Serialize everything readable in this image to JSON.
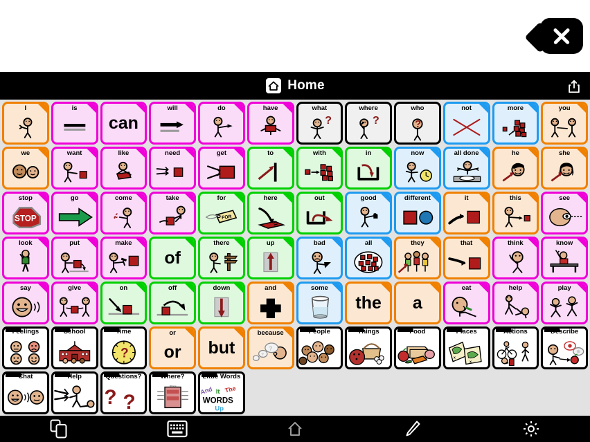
{
  "window": {
    "close_label": "close",
    "close_icon": "close-x-icon"
  },
  "header": {
    "title": "Home",
    "home_icon": "home-icon",
    "share_icon": "share-icon"
  },
  "grid": {
    "columns": 12,
    "rows": 7,
    "colors": {
      "pronoun_orange": "#F08000",
      "verb_magenta": "#F000D8",
      "preposition_green": "#00D000",
      "descriptor_blue": "#1E9BF0",
      "question_white": "#000000",
      "folder_black": "#000000"
    },
    "cells": [
      {
        "label": "I",
        "theme": "c-orange",
        "art": "person-point-self"
      },
      {
        "label": "is",
        "theme": "c-magenta",
        "art": "equals-bars"
      },
      {
        "label": "can",
        "theme": "c-magenta",
        "art": "word-can",
        "word": "can"
      },
      {
        "label": "will",
        "theme": "c-magenta",
        "art": "arrow-right-bar"
      },
      {
        "label": "do",
        "theme": "c-magenta",
        "art": "person-reaching"
      },
      {
        "label": "have",
        "theme": "c-magenta",
        "art": "person-holding-box"
      },
      {
        "label": "what",
        "theme": "c-white",
        "art": "person-question-shrug"
      },
      {
        "label": "where",
        "theme": "c-white",
        "art": "person-question-look"
      },
      {
        "label": "who",
        "theme": "c-white",
        "art": "person-question-head"
      },
      {
        "label": "not",
        "theme": "c-blue",
        "art": "red-x"
      },
      {
        "label": "more",
        "theme": "c-blue",
        "art": "blocks-pile-add"
      },
      {
        "label": "you",
        "theme": "c-orange",
        "art": "two-people-point"
      },
      {
        "label": "we",
        "theme": "c-orange",
        "art": "two-faces"
      },
      {
        "label": "want",
        "theme": "c-magenta",
        "art": "person-reach-box"
      },
      {
        "label": "like",
        "theme": "c-magenta",
        "art": "person-hug-box"
      },
      {
        "label": "need",
        "theme": "c-magenta",
        "art": "hands-toward-box"
      },
      {
        "label": "get",
        "theme": "c-magenta",
        "art": "hands-grab-box"
      },
      {
        "label": "to",
        "theme": "c-green",
        "art": "arrow-to-line"
      },
      {
        "label": "with",
        "theme": "c-green",
        "art": "block-joining-group"
      },
      {
        "label": "in",
        "theme": "c-green",
        "art": "arrow-into-container"
      },
      {
        "label": "now",
        "theme": "c-blue",
        "art": "person-clock"
      },
      {
        "label": "all done",
        "theme": "c-blue",
        "art": "person-empty-plate"
      },
      {
        "label": "he",
        "theme": "c-orange",
        "art": "boy-face-arrow"
      },
      {
        "label": "she",
        "theme": "c-orange",
        "art": "girl-face-arrow"
      },
      {
        "label": "stop",
        "theme": "c-magenta",
        "art": "stop-sign"
      },
      {
        "label": "go",
        "theme": "c-magenta",
        "art": "green-arrow"
      },
      {
        "label": "come",
        "theme": "c-magenta",
        "art": "person-beckon"
      },
      {
        "label": "take",
        "theme": "c-magenta",
        "art": "person-take-box"
      },
      {
        "label": "for",
        "theme": "c-green",
        "art": "gift-tag-for"
      },
      {
        "label": "here",
        "theme": "c-green",
        "art": "hand-point-surface"
      },
      {
        "label": "out",
        "theme": "c-green",
        "art": "arrow-out-container"
      },
      {
        "label": "good",
        "theme": "c-blue",
        "art": "person-thumbs-up"
      },
      {
        "label": "different",
        "theme": "c-blue",
        "art": "square-and-circle"
      },
      {
        "label": "it",
        "theme": "c-orange",
        "art": "hand-point-box"
      },
      {
        "label": "this",
        "theme": "c-orange",
        "art": "person-point-box"
      },
      {
        "label": "see",
        "theme": "c-magenta",
        "art": "eye-sight-line"
      },
      {
        "label": "look",
        "theme": "c-magenta",
        "art": "person-looking"
      },
      {
        "label": "put",
        "theme": "c-magenta",
        "art": "person-put-box"
      },
      {
        "label": "make",
        "theme": "c-magenta",
        "art": "person-hammer-box"
      },
      {
        "label": "of",
        "theme": "c-green",
        "art": "word-of",
        "word": "of"
      },
      {
        "label": "there",
        "theme": "c-green",
        "art": "person-signpost"
      },
      {
        "label": "up",
        "theme": "c-green",
        "art": "arrow-up-box"
      },
      {
        "label": "bad",
        "theme": "c-blue",
        "art": "person-thumbs-down"
      },
      {
        "label": "all",
        "theme": "c-blue",
        "art": "blocks-circled"
      },
      {
        "label": "they",
        "theme": "c-orange",
        "art": "group-people-arrow"
      },
      {
        "label": "that",
        "theme": "c-orange",
        "art": "hand-point-far-box"
      },
      {
        "label": "think",
        "theme": "c-magenta",
        "art": "person-thinking"
      },
      {
        "label": "know",
        "theme": "c-magenta",
        "art": "person-hand-raised-desk"
      },
      {
        "label": "say",
        "theme": "c-magenta",
        "art": "face-speaking"
      },
      {
        "label": "give",
        "theme": "c-magenta",
        "art": "person-give-box"
      },
      {
        "label": "on",
        "theme": "c-green",
        "art": "arrow-onto-surface"
      },
      {
        "label": "off",
        "theme": "c-green",
        "art": "arrow-off-surface"
      },
      {
        "label": "down",
        "theme": "c-green",
        "art": "arrow-down-box"
      },
      {
        "label": "and",
        "theme": "c-orange",
        "art": "plus-sign"
      },
      {
        "label": "some",
        "theme": "c-blue",
        "art": "glass-partly-full"
      },
      {
        "label": "the",
        "theme": "c-orange",
        "art": "word-the",
        "word": "the"
      },
      {
        "label": "a",
        "theme": "c-orange",
        "art": "word-a",
        "word": "a"
      },
      {
        "label": "eat",
        "theme": "c-magenta",
        "art": "person-eating"
      },
      {
        "label": "help",
        "theme": "c-magenta",
        "art": "person-helping"
      },
      {
        "label": "play",
        "theme": "c-magenta",
        "art": "two-people-running"
      },
      {
        "label": "Feelings",
        "theme": "c-folder",
        "art": "four-faces"
      },
      {
        "label": "School",
        "theme": "c-folder",
        "art": "school-building"
      },
      {
        "label": "Time",
        "theme": "c-folder",
        "art": "clock-question"
      },
      {
        "label": "or",
        "theme": "c-orange",
        "art": "word-or",
        "word": "or"
      },
      {
        "label": "but",
        "theme": "c-orange",
        "art": "word-but",
        "word": "but"
      },
      {
        "label": "because",
        "theme": "c-orange",
        "art": "speech-bubbles-question"
      },
      {
        "label": "People",
        "theme": "c-folder",
        "art": "crowd-faces"
      },
      {
        "label": "Things",
        "theme": "c-folder",
        "art": "basket-ball-objects"
      },
      {
        "label": "Food",
        "theme": "c-folder",
        "art": "bread-apple-carrot"
      },
      {
        "label": "Places",
        "theme": "c-folder",
        "art": "two-maps"
      },
      {
        "label": "Actions",
        "theme": "c-folder",
        "art": "cyclist-walker"
      },
      {
        "label": "Describe",
        "theme": "c-folder",
        "art": "person-describing-apple"
      },
      {
        "label": "Chat",
        "theme": "c-folder",
        "art": "two-faces-talking"
      },
      {
        "label": "Help",
        "theme": "c-folder",
        "art": "hands-helping-person"
      },
      {
        "label": "Questions?",
        "theme": "c-folder",
        "art": "two-question-marks"
      },
      {
        "label": "Where?",
        "theme": "c-folder",
        "art": "red-sign-board"
      },
      {
        "label": "Little Words",
        "theme": "c-folder",
        "art": "words-collage"
      }
    ]
  },
  "toolbar": {
    "items": [
      {
        "name": "pages-icon",
        "label": "Pages"
      },
      {
        "name": "keyboard-icon",
        "label": "Keyboard"
      },
      {
        "name": "home-icon",
        "label": "Home"
      },
      {
        "name": "edit-icon",
        "label": "Edit"
      },
      {
        "name": "settings-icon",
        "label": "Settings"
      }
    ]
  }
}
